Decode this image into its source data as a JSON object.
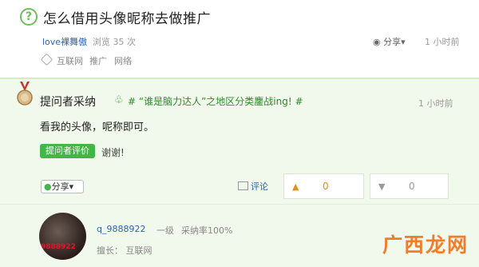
{
  "question": {
    "title": "怎么借用头像昵称去做推广",
    "user": "love裸舞傲",
    "views": "浏览 35 次",
    "share": "分享▾",
    "time": "1 小时前",
    "tags": [
      "互联网",
      "推广",
      "网络"
    ]
  },
  "answer": {
    "label": "提问者采纳",
    "topic_icon": "♧",
    "topic": "# “谁是脑力达人”之地区分类鏖战ing! #",
    "time": "1 小时前",
    "text": "看我的头像，呢称即可。",
    "eval_button": "提问者评价",
    "eval_reply": "谢谢!",
    "share_button": "分享▾",
    "comment_label": "评论",
    "upvotes": "0",
    "downvotes": "0"
  },
  "answerer": {
    "avatar_text": "9888922",
    "name": "q_9888922",
    "level": "一级",
    "adopt_rate": "采纳率100%",
    "good_at": "擅长：  互联网"
  },
  "watermark": "广西龙网",
  "colors": {
    "accent": "#44b549",
    "link": "#2d64b3",
    "answer_bg": "#f1f9ec",
    "vote": "#e08e1e"
  }
}
